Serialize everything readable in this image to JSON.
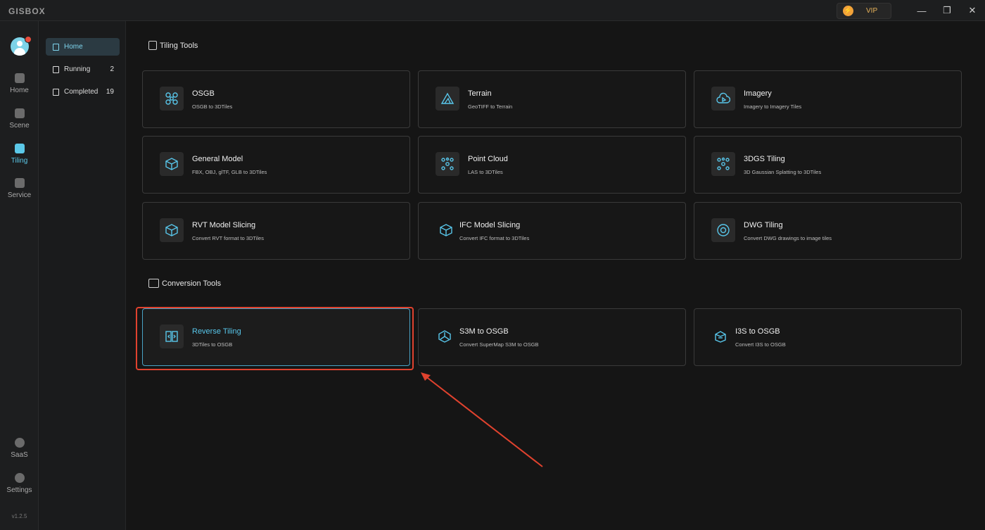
{
  "app": {
    "logo": "GISBOX"
  },
  "titlebar": {
    "vip_label": "VIP",
    "minimize": "—",
    "restore": "❐",
    "close": "✕"
  },
  "rail": {
    "items": [
      {
        "label": "Home"
      },
      {
        "label": "Scene"
      },
      {
        "label": "Tiling"
      },
      {
        "label": "Service"
      },
      {
        "label": "SaaS"
      },
      {
        "label": "Settings"
      }
    ],
    "version": "v1.2.5"
  },
  "sidebar": {
    "items": [
      {
        "label": "Home",
        "count": ""
      },
      {
        "label": "Running",
        "count": "2"
      },
      {
        "label": "Completed",
        "count": "19"
      }
    ]
  },
  "tiling_tools": {
    "title": "Tiling Tools",
    "cards": [
      {
        "title": "OSGB",
        "subtitle": "OSGB to 3DTiles",
        "icon": "drone-icon"
      },
      {
        "title": "Terrain",
        "subtitle": "GeoTIFF to Terrain",
        "icon": "mountain-icon"
      },
      {
        "title": "Imagery",
        "subtitle": "Imagery to Imagery Tiles",
        "icon": "cloud-play-icon"
      },
      {
        "title": "General Model",
        "subtitle": "FBX, OBJ, glTF, GLB to 3DTiles",
        "icon": "cube-icon"
      },
      {
        "title": "Point Cloud",
        "subtitle": "LAS to 3DTiles",
        "icon": "points-icon"
      },
      {
        "title": "3DGS Tiling",
        "subtitle": "3D Gaussian Splatting to 3DTiles",
        "icon": "points-icon"
      },
      {
        "title": "RVT Model Slicing",
        "subtitle": "Convert RVT format to 3DTiles",
        "icon": "cube-icon"
      },
      {
        "title": "IFC Model Slicing",
        "subtitle": "Convert IFC format to 3DTiles",
        "icon": "cube-outline-icon"
      },
      {
        "title": "DWG Tiling",
        "subtitle": "Convert DWG drawings to image tiles",
        "icon": "circle-icon"
      }
    ]
  },
  "conversion_tools": {
    "title": "Conversion Tools",
    "cards": [
      {
        "title": "Reverse Tiling",
        "subtitle": "3DTiles to OSGB",
        "icon": "reverse-icon"
      },
      {
        "title": "S3M to OSGB",
        "subtitle": "Convert SuperMap S3M to OSGB",
        "icon": "triangle-node-icon"
      },
      {
        "title": "I3S to OSGB",
        "subtitle": "Convert I3S to OSGB",
        "icon": "box-open-icon"
      }
    ]
  },
  "colors": {
    "accent": "#58c6ea",
    "highlight_border": "#e0422e",
    "vip": "#f2a23a"
  }
}
